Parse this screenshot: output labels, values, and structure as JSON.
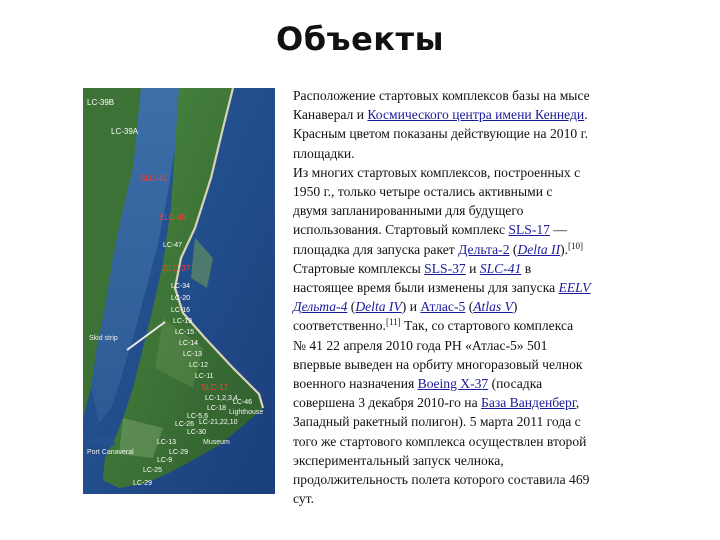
{
  "slide": {
    "title": "Объекты"
  },
  "map": {
    "pad_labels": [
      {
        "id": "lc39b",
        "text": "LC-39B",
        "active": false
      },
      {
        "id": "lc39a",
        "text": "LC-39A",
        "active": false
      },
      {
        "id": "slc41",
        "text": "SLC-41",
        "active": true
      },
      {
        "id": "slc40",
        "text": "SLC-40",
        "active": true
      },
      {
        "id": "lc47",
        "text": "LC-47",
        "active": false
      },
      {
        "id": "slc37",
        "text": "SLC-37",
        "active": true
      },
      {
        "id": "lc34",
        "text": "LC-34",
        "active": false
      },
      {
        "id": "lc20",
        "text": "LC-20",
        "active": false
      },
      {
        "id": "lc16",
        "text": "LC-16",
        "active": false
      },
      {
        "id": "lc19",
        "text": "LC-19",
        "active": false
      },
      {
        "id": "lc15",
        "text": "LC-15",
        "active": false
      },
      {
        "id": "lc14",
        "text": "LC-14",
        "active": false
      },
      {
        "id": "lc13",
        "text": "LC-13",
        "active": false
      },
      {
        "id": "lc12",
        "text": "LC-12",
        "active": false
      },
      {
        "id": "lc11",
        "text": "LC-11",
        "active": false
      },
      {
        "id": "slc17",
        "text": "SLC-17",
        "active": true
      },
      {
        "id": "lc1234",
        "text": "LC-1,2,3,4",
        "active": false
      },
      {
        "id": "lc18",
        "text": "LC-18",
        "active": false
      },
      {
        "id": "lc5",
        "text": "LC-5,6",
        "active": false
      },
      {
        "id": "lc26",
        "text": "LC-26",
        "active": false
      },
      {
        "id": "lc30",
        "text": "LC-30",
        "active": false
      },
      {
        "id": "lc21",
        "text": "LC-21,22,10",
        "active": false
      },
      {
        "id": "lc46",
        "text": "LC-46",
        "active": false
      },
      {
        "id": "lc13b",
        "text": "LC-13",
        "active": false
      },
      {
        "id": "lc29",
        "text": "LC-29",
        "active": false
      },
      {
        "id": "lc9",
        "text": "LC-9",
        "active": false
      },
      {
        "id": "lc25",
        "text": "LC-25",
        "active": false
      },
      {
        "id": "lc29b",
        "text": "LC-29",
        "active": false
      }
    ],
    "places": {
      "skid_strip": "Skid strip",
      "port_canaveral": "Port Canaveral",
      "lighthouse": "Lighthouse",
      "museum": "Museum"
    }
  },
  "article": {
    "l1": "Расположение стартовых комплексов базы на мысе",
    "l2_pre": "Канаверал и ",
    "l2_link": "Космического центра имени Кеннеди",
    "l2_post": ".",
    "l3": "Красным цветом показаны действующие на 2010 г.",
    "l4": "площадки.",
    "l5": "Из многих стартовых комплексов, построенных с",
    "l6": "1950 г., только четыре остались активными с",
    "l7": "двумя запланированными для будущего",
    "l8_pre": "использования. Стартовый комплекс ",
    "l8_link": "SLS-17",
    "l8_post": " —",
    "l9_pre": "площадка для запуска ракет ",
    "l9_link1": "Дельта-2",
    "l9_mid": " (",
    "l9_link2": "Delta II",
    "l9_post": ").",
    "l9_ref": "[10]",
    "l10_pre": "Стартовые комплексы ",
    "l10_link1": "SLS-37",
    "l10_mid": " и ",
    "l10_link2": "SLC-41",
    "l10_post": " в",
    "l11_pre": "настоящее время были изменены для запуска ",
    "l11_link": "EELV",
    "l12_link1": "Дельта-4",
    "l12_a": " (",
    "l12_link2": "Delta IV",
    "l12_b": ") и ",
    "l12_link3": "Атлас-5",
    "l12_c": " (",
    "l12_link4": "Atlas V",
    "l12_d": ")",
    "l13_pre": "соответственно.",
    "l13_ref": "[11]",
    "l13_post": " Так, со стартового комплекса",
    "l14": "№ 41 22 апреля 2010 года РН «Атлас-5» 501",
    "l15": "впервые выведен на орбиту многоразовый челнок",
    "l16_pre": "военного назначения ",
    "l16_link": "Boeing X-37",
    "l16_post": " (посадка",
    "l17_pre": "совершена 3 декабря 2010-го на ",
    "l17_link": "База Ванденберг",
    "l17_post": ",",
    "l18": "Западный ракетный полигон). 5 марта 2011 года с",
    "l19": "того же стартового комплекса осуществлен второй",
    "l20": "экспериментальный запуск челнока,",
    "l21": "продолжительность полета которого составила 469",
    "l22": "сут."
  },
  "colors": {
    "ocean": "#1f4d8e",
    "land": "#3f7a3a",
    "beach": "#d9d3b8",
    "link": "#1a1a9a",
    "active_pad": "#ff3b30"
  }
}
